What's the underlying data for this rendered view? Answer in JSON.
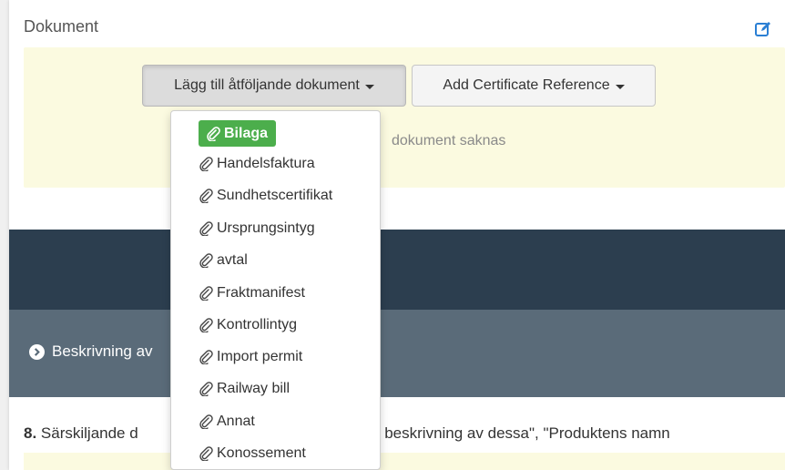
{
  "documents": {
    "title": "Dokument",
    "add_accompanying_label": "Lägg till åtföljande dokument",
    "add_certificate_label": "Add Certificate Reference",
    "empty_text": "dokument saknas"
  },
  "dropdown": {
    "items": [
      {
        "label": "Bilaga",
        "active": true
      },
      {
        "label": "Handelsfaktura"
      },
      {
        "label": "Sundhetscertifikat"
      },
      {
        "label": "Ursprungsintyg"
      },
      {
        "label": "avtal"
      },
      {
        "label": "Fraktmanifest"
      },
      {
        "label": "Kontrollintyg"
      },
      {
        "label": "Import permit"
      },
      {
        "label": "Railway bill"
      },
      {
        "label": "Annat"
      },
      {
        "label": "Konossement"
      }
    ]
  },
  "section": {
    "heading": "Beskrivning av"
  },
  "question": {
    "number": "8.",
    "text_start": " Särskiljande d",
    "text_end": "r och beskrivning av dessa\", \"Produktens namn"
  },
  "icons": {
    "edit": "edit-icon",
    "attachment": "paperclip-icon",
    "chevron": "circle-chevron-right-icon"
  },
  "colors": {
    "accent_blue": "#2a7fd4",
    "active_green": "#4cae4c",
    "dark_band": "#2c3e4f",
    "slate_band": "#5a6b79",
    "panel_yellow": "#fbfae0"
  }
}
